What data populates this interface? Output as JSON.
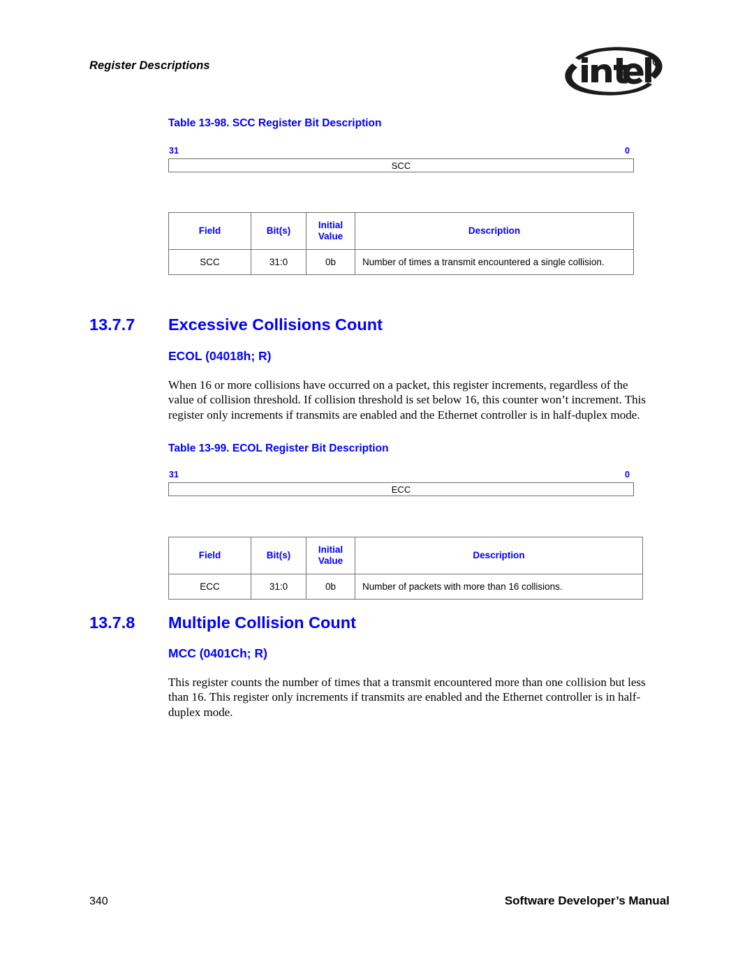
{
  "header": {
    "running_head": "Register Descriptions",
    "logo_name": "intel-logo",
    "logo_text": "intel"
  },
  "sections": [
    {
      "caption": "Table 13-98. SCC Register Bit Description",
      "register": {
        "msb": "31",
        "lsb": "0",
        "label": "SCC"
      },
      "table": {
        "headers": [
          "Field",
          "Bit(s)",
          "Initial",
          "Value",
          "Description"
        ],
        "header_field": "Field",
        "header_bits": "Bit(s)",
        "header_initial_line1": "Initial",
        "header_initial_line2": "Value",
        "header_description": "Description",
        "rows": [
          {
            "field": "SCC",
            "bits": "31:0",
            "initial": "0b",
            "description": "Number of times a transmit encountered a single collision."
          }
        ]
      }
    },
    {
      "number": "13.7.7",
      "title": "Excessive Collisions Count",
      "subtitle": "ECOL (04018h; R)",
      "body": "When 16 or more collisions have occurred on a packet, this register increments, regardless of the value of collision threshold. If collision threshold is set below 16, this counter won’t increment. This register only increments if transmits are enabled and the Ethernet controller is in half-duplex mode.",
      "caption": "Table 13-99. ECOL Register Bit Description",
      "register": {
        "msb": "31",
        "lsb": "0",
        "label": "ECC"
      },
      "table": {
        "header_field": "Field",
        "header_bits": "Bit(s)",
        "header_initial_line1": "Initial",
        "header_initial_line2": "Value",
        "header_description": "Description",
        "rows": [
          {
            "field": "ECC",
            "bits": "31:0",
            "initial": "0b",
            "description": "Number of packets with more than 16 collisions."
          }
        ]
      }
    },
    {
      "number": "13.7.8",
      "title": "Multiple Collision Count",
      "subtitle": "MCC (0401Ch; R)",
      "body": "This register counts the number of times that a transmit encountered more than one collision but less than 16. This register only increments if transmits are enabled and the Ethernet controller is in half-duplex mode."
    }
  ],
  "footer": {
    "page_number": "340",
    "manual_title": "Software Developer’s Manual"
  },
  "colors": {
    "heading_blue": "#0000ff",
    "text_black": "#000000",
    "rule_gray": "#6f6f6f",
    "page_background": "#ffffff"
  }
}
